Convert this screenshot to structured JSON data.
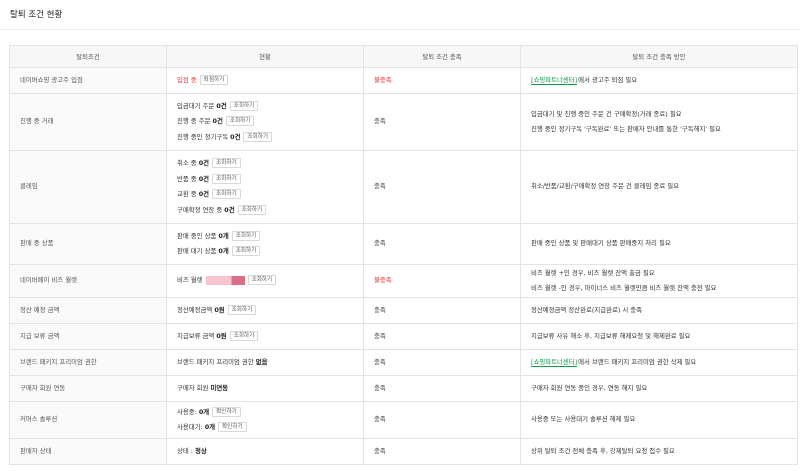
{
  "page": {
    "title": "탈퇴 조건 현황"
  },
  "headers": [
    "탈퇴조건",
    "현황",
    "탈퇴 조건 충족",
    "탈퇴 조건 충족 방안"
  ],
  "rows": [
    {
      "name": "네이버쇼핑 광고주 입점",
      "status": [
        {
          "pre": "",
          "val": "입점 중",
          "post": "",
          "red": true,
          "btn": "퇴점하기"
        }
      ],
      "meet": "불충족",
      "unmet": true,
      "solution": [
        {
          "link": "[쇼핑파트너센터]",
          "text": "에서 광고주 퇴점 필요"
        }
      ]
    },
    {
      "name": "진행 중 거래",
      "status": [
        {
          "pre": "입금대기 주문 ",
          "val": "0건",
          "post": "",
          "btn": "조회하기"
        },
        {
          "pre": "진행 중 주문 ",
          "val": "0건",
          "post": "",
          "btn": "조회하기"
        },
        {
          "pre": "진행 중인 정기구독 ",
          "val": "0건",
          "post": "",
          "btn": "조회하기"
        }
      ],
      "meet": "충족",
      "unmet": false,
      "solution": [
        {
          "link": "",
          "text": "입금대기 및 진행 중인 주문 건 구매확정(거래 종료) 필요"
        },
        {
          "link": "",
          "text": "진행 중인 정기구독 '구독완료' 또는 판매자 안내를 통한 '구독해지' 필요"
        }
      ]
    },
    {
      "name": "클레임",
      "status": [
        {
          "pre": "취소 중 ",
          "val": "0건",
          "post": "",
          "btn": "조회하기"
        },
        {
          "pre": "반품 중 ",
          "val": "0건",
          "post": "",
          "btn": "조회하기"
        },
        {
          "pre": "교환 중 ",
          "val": "0건",
          "post": "",
          "btn": "조회하기"
        },
        {
          "pre": "구매확정 연장 중 ",
          "val": "0건",
          "post": "",
          "btn": "조회하기"
        }
      ],
      "meet": "충족",
      "unmet": false,
      "solution": [
        {
          "link": "",
          "text": "취소/반품/교환/구매확정 연장 주문 건 클레임 종료 필요"
        }
      ]
    },
    {
      "name": "판매 중 상품",
      "status": [
        {
          "pre": "판매 중인 상품 ",
          "val": "0개",
          "post": "",
          "btn": "조회하기"
        },
        {
          "pre": "판매 대기 상품 ",
          "val": "0개",
          "post": "",
          "btn": "조회하기"
        }
      ],
      "meet": "충족",
      "unmet": false,
      "solution": [
        {
          "link": "",
          "text": "판매 중인 상품 및 판매대기 상품 판매중지 처리 필요"
        }
      ]
    },
    {
      "name": "네이버페이 비즈 월렛",
      "status": [
        {
          "pre": "비즈 월렛 ",
          "val": "",
          "post": "",
          "bar": true,
          "btn": "조회하기"
        }
      ],
      "meet": "불충족",
      "unmet": true,
      "solution": [
        {
          "link": "",
          "text": "비즈 월렛 +인 경우, 비즈 월렛 잔액 출금 필요"
        },
        {
          "link": "",
          "text": "비즈 월렛 -인 경우, 마이너스 비즈 월렛만큼 비즈 월렛 잔액 충전 필요"
        }
      ]
    },
    {
      "name": "정산 예정 금액",
      "status": [
        {
          "pre": "정산예정금액 ",
          "val": "0원",
          "post": "",
          "btn": "조회하기"
        }
      ],
      "meet": "충족",
      "unmet": false,
      "solution": [
        {
          "link": "",
          "text": "정산예정금액 정산완료(지급완료) 시 충족"
        }
      ]
    },
    {
      "name": "지급 보류 금액",
      "status": [
        {
          "pre": "지급보류 금액 ",
          "val": "0원",
          "post": "",
          "btn": "조회하기"
        }
      ],
      "meet": "충족",
      "unmet": false,
      "solution": [
        {
          "link": "",
          "text": "지급보류 사유 해소 후, 지급보류 해제요청 및 해제완료 필요"
        }
      ]
    },
    {
      "name": "브랜드 패키지 프리미엄 권한",
      "status": [
        {
          "pre": "브랜드 패키지 프리미엄 권한 ",
          "val": "없음",
          "post": "",
          "btn": ""
        }
      ],
      "meet": "충족",
      "unmet": false,
      "solution": [
        {
          "link": "[쇼핑파트너센터]",
          "text": "에서 브랜드 패키지 프리미엄 권한 삭제 필요"
        }
      ]
    },
    {
      "name": "구매자 회원 연동",
      "status": [
        {
          "pre": "구매자 회원 ",
          "val": "미연동",
          "post": "",
          "btn": ""
        }
      ],
      "meet": "충족",
      "unmet": false,
      "solution": [
        {
          "link": "",
          "text": "구매자 회원 연동 중인 경우, 연동 해지 필요"
        }
      ]
    },
    {
      "name": "커머스 솔루션",
      "status": [
        {
          "pre": "사용중: ",
          "val": "0개",
          "post": "",
          "btn": "확인하기"
        },
        {
          "pre": "사용대기: ",
          "val": "0개",
          "post": "",
          "btn": "확인하기"
        }
      ],
      "meet": "충족",
      "unmet": false,
      "solution": [
        {
          "link": "",
          "text": "사용중 또는 사용대기 솔루션 해제 필요"
        }
      ]
    },
    {
      "name": "판매자 상태",
      "status": [
        {
          "pre": "상태 : ",
          "val": "정상",
          "post": "",
          "btn": ""
        }
      ],
      "meet": "충족",
      "unmet": false,
      "solution": [
        {
          "link": "",
          "text": "상위 탈퇴 조건 전체 충족 후, 강제탈퇴 요청 접수 필요"
        }
      ]
    }
  ]
}
